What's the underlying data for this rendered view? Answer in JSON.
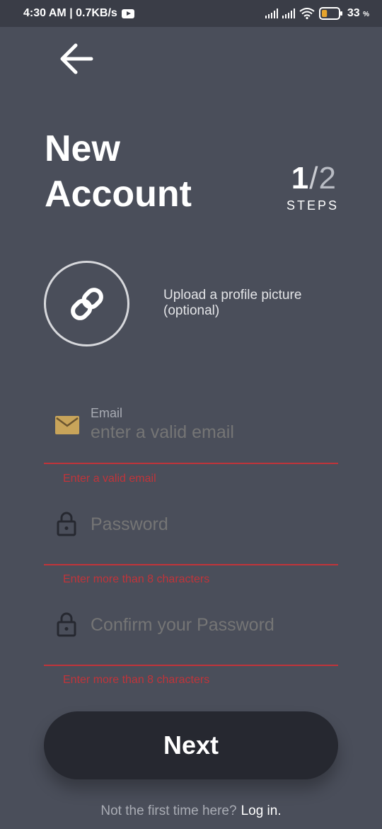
{
  "status_bar": {
    "time_speed": "4:30 AM | 0.7KB/s",
    "battery_number": "33",
    "battery_unit": "%",
    "battery_fraction": 0.33,
    "battery_color": "#e6a42d"
  },
  "header": {
    "back_icon": "arrow-left-icon",
    "title_line1": "New",
    "title_line2": "Account",
    "step_current": "1",
    "step_separator": "/",
    "step_total": "2",
    "step_label": "STEPS"
  },
  "upload": {
    "icon": "link-icon",
    "text": "Upload a profile picture (optional)"
  },
  "fields": {
    "email": {
      "icon": "envelope-icon",
      "label": "Email",
      "placeholder": "enter a valid email",
      "error": "Enter a valid email"
    },
    "password": {
      "icon": "lock-icon",
      "placeholder": "Password",
      "error": "Enter more than 8 characters"
    },
    "confirm_password": {
      "icon": "lock-icon",
      "placeholder": "Confirm your Password",
      "error": "Enter more than 8 characters"
    }
  },
  "actions": {
    "next_label": "Next"
  },
  "footer": {
    "prompt": "Not the first time here?",
    "login_link": "Log in."
  },
  "colors": {
    "background": "#4a4e5a",
    "status_bar": "#3a3d47",
    "button": "#262830",
    "error": "#c0343a",
    "envelope": "#c8a45a"
  }
}
